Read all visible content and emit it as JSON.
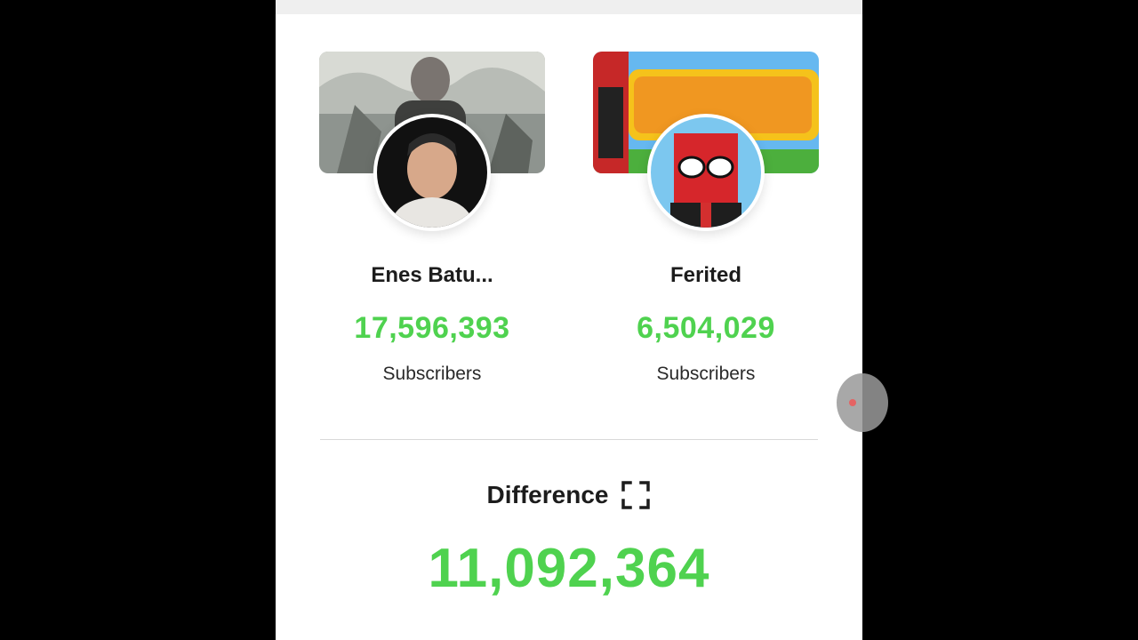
{
  "channels": [
    {
      "name": "Enes Batu...",
      "subscribers": "17,596,393",
      "subscribers_label": "Subscribers",
      "banner_icon": "channel-banner-image",
      "avatar_icon": "channel-avatar-image"
    },
    {
      "name": "Ferited",
      "subscribers": "6,504,029",
      "subscribers_label": "Subscribers",
      "banner_icon": "channel-banner-image",
      "avatar_icon": "channel-avatar-image"
    }
  ],
  "difference": {
    "label": "Difference",
    "value": "11,092,364",
    "icon": "fullscreen-icon"
  },
  "colors": {
    "count_green": "#4fd24f",
    "text_dark": "#1c1c1c",
    "card_bg": "#ffffff",
    "page_bg": "#000000"
  }
}
